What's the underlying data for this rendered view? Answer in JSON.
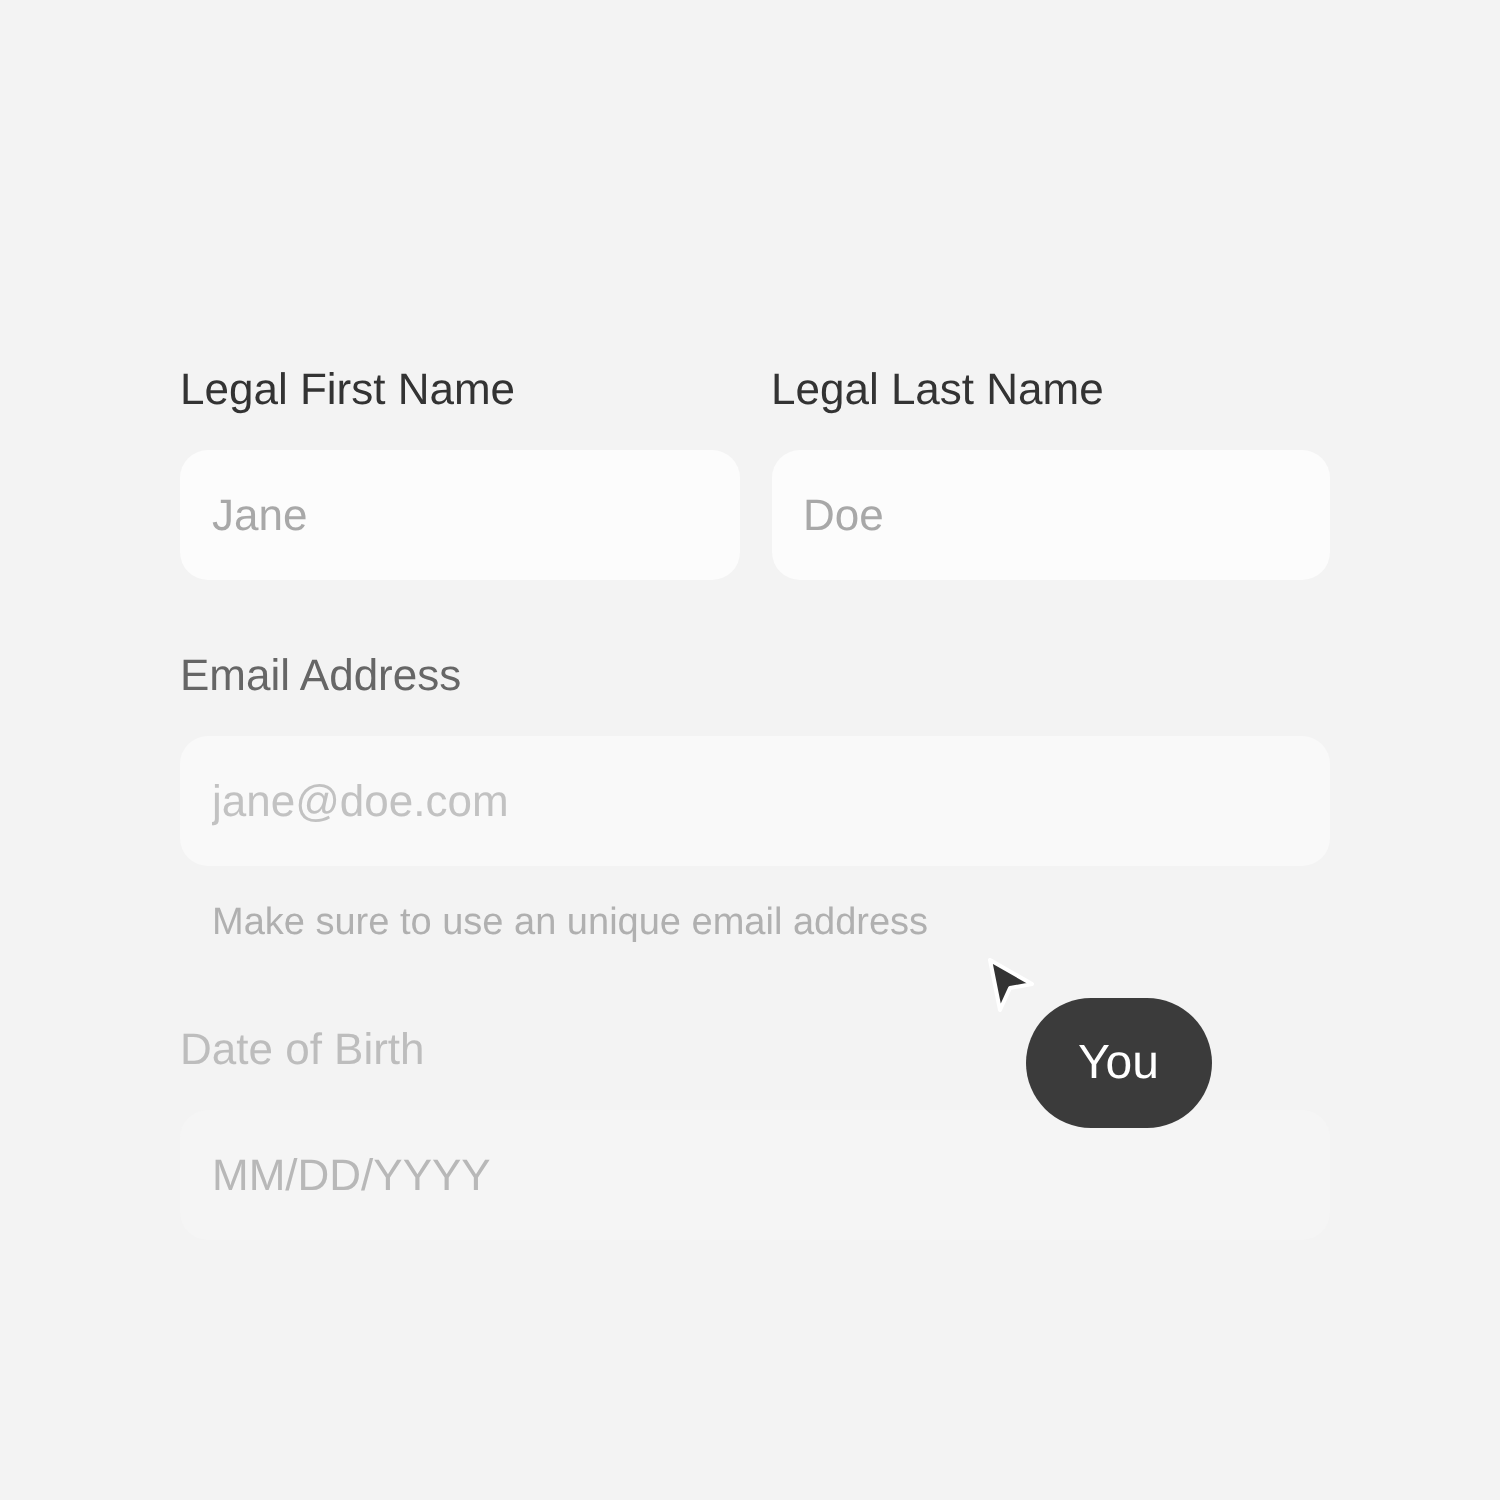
{
  "name_fields": [
    {
      "label": "Legal First Name",
      "placeholder": "Jane"
    },
    {
      "label": "Legal Last Name",
      "placeholder": "Doe"
    }
  ],
  "email": {
    "label": "Email Address",
    "placeholder": "jane@doe.com",
    "hint": "Make sure to use an unique email address"
  },
  "birth_date": {
    "label": "Date of Birth",
    "placeholder": "MM/DD/YYYY"
  },
  "cursor_tag": {
    "label": "You"
  }
}
